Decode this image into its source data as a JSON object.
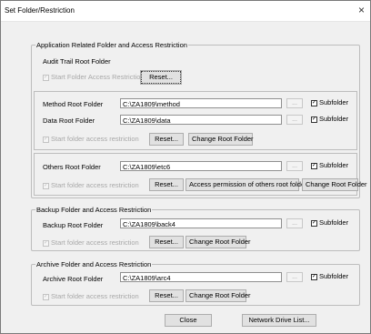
{
  "window": {
    "title": "Set Folder/Restriction",
    "close": "×"
  },
  "app_group": {
    "title": "Application Related Folder and Access Restriction",
    "audit": {
      "label": "Audit Trail Root Folder",
      "restrict_label": "Start Folder Access Restriction",
      "reset": "Reset..."
    },
    "method": {
      "label": "Method Root Folder",
      "value": "C:\\ZA1809\\method",
      "dots": "...",
      "subfolder": "Subfolder"
    },
    "data": {
      "label": "Data Root Folder",
      "value": "C:\\ZA1809\\data",
      "dots": "...",
      "subfolder": "Subfolder",
      "restrict_label": "Start folder access restriction",
      "reset": "Reset...",
      "change": "Change Root Folder"
    },
    "others": {
      "label": "Others Root Folder",
      "value": "C:\\ZA1809\\etc6",
      "dots": "...",
      "subfolder": "Subfolder",
      "restrict_label": "Start folder access restriction",
      "reset": "Reset...",
      "permission": "Access permission of others root folder...",
      "change": "Change Root Folder"
    }
  },
  "backup_group": {
    "title": "Backup Folder and Access Restriction",
    "label": "Backup Root Folder",
    "value": "C:\\ZA1809\\back4",
    "dots": "...",
    "subfolder": "Subfolder",
    "restrict_label": "Start folder access restriction",
    "reset": "Reset...",
    "change": "Change Root Folder"
  },
  "archive_group": {
    "title": "Archive Folder and Access Restriction",
    "label": "Archive Root Folder",
    "value": "C:\\ZA1809\\arc4",
    "dots": "...",
    "subfolder": "Subfolder",
    "restrict_label": "Start folder access restriction",
    "reset": "Reset...",
    "change": "Change Root Folder"
  },
  "footer": {
    "close": "Close",
    "network": "Network Drive List..."
  },
  "checkmark": "✓"
}
